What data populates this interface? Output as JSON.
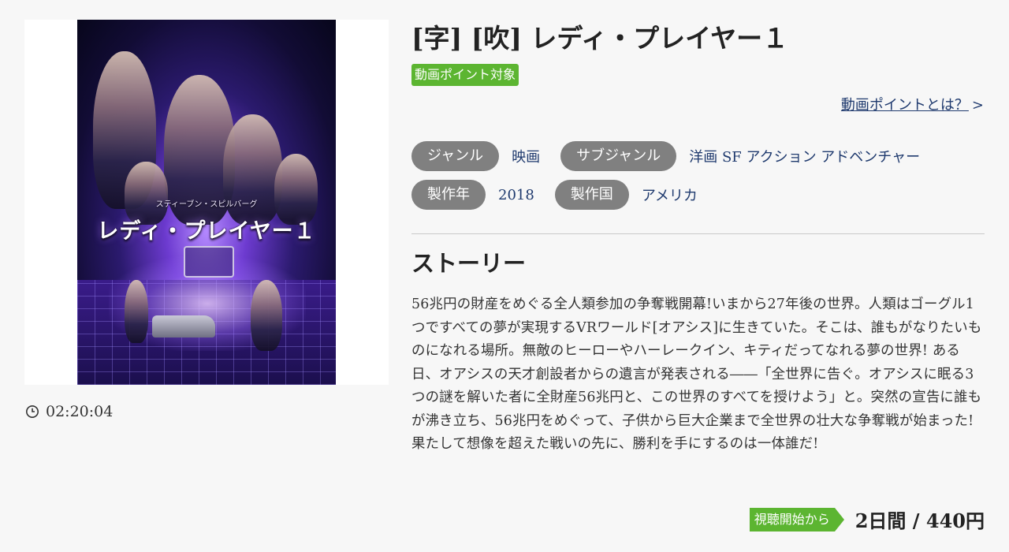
{
  "movie": {
    "title": "[字] [吹] レディ・プレイヤー１",
    "point_badge": "動画ポイント対象",
    "point_link": {
      "label": "動画ポイントとは？",
      "arrow": ">"
    },
    "duration": "02:20:04"
  },
  "poster": {
    "title_art": "レディ・プレイヤー１",
    "sub_art": "スティーブン・スピルバーグ"
  },
  "meta": {
    "genre_label": "ジャンル",
    "genre_value": "映画",
    "subgenre_label": "サブジャンル",
    "subgenre_value": "洋画 SF アクション アドベンチャー",
    "year_label": "製作年",
    "year_value": "2018",
    "country_label": "製作国",
    "country_value": "アメリカ"
  },
  "story": {
    "heading": "ストーリー",
    "text": "56兆円の財産をめぐる全人類参加の争奪戦開幕!いまから27年後の世界。人類はゴーグル1つですべての夢が実現するVRワールド[オアシス]に生きていた。そこは、誰もがなりたいものになれる場所。無敵のヒーローやハーレークイン、キティだってなれる夢の世界! ある日、オアシスの天才創設者からの遺言が発表される――「全世界に告ぐ。オアシスに眠る3つの謎を解いた者に全財産56兆円と、この世界のすべてを授けよう」と。突然の宣告に誰もが沸き立ち、56兆円をめぐって、子供から巨大企業まで全世界の壮大な争奪戦が始まった! 果たして想像を超えた戦いの先に、勝利を手にするのは一体誰だ!"
  },
  "price": {
    "tag": "視聴開始から",
    "value": "2日間 / 440円"
  },
  "colors": {
    "accent_green": "#5cb531",
    "pill_gray": "#808080",
    "link_blue": "#1f3a6e",
    "background": "#f7f7f7"
  }
}
